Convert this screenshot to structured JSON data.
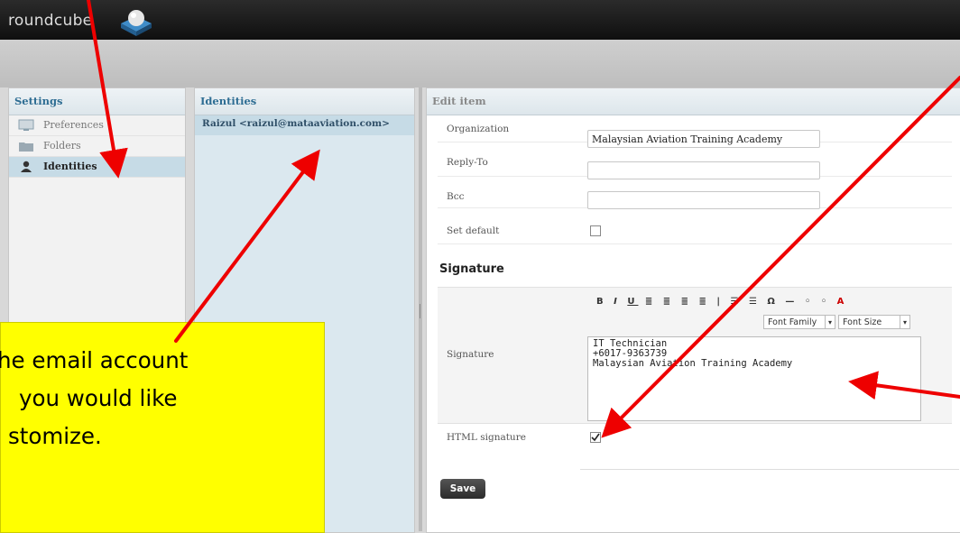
{
  "header": {
    "logo_text": "roundcube"
  },
  "settings": {
    "title": "Settings",
    "items": [
      {
        "label": "Preferences",
        "icon": "monitor-icon"
      },
      {
        "label": "Folders",
        "icon": "folder-icon"
      },
      {
        "label": "Identities",
        "icon": "user-icon",
        "selected": true
      }
    ]
  },
  "identities": {
    "title": "Identities",
    "items": [
      {
        "label": "Raizul <raizul@mataaviation.com>"
      }
    ]
  },
  "edit": {
    "title": "Edit item",
    "organization_label": "Organization",
    "organization_value": "Malaysian Aviation Training Academy",
    "replyto_label": "Reply-To",
    "replyto_value": "",
    "bcc_label": "Bcc",
    "bcc_value": "",
    "setdefault_label": "Set default",
    "section_title": "Signature",
    "signature_label": "Signature",
    "font_family": "Font Family",
    "font_size": "Font Size",
    "signature_lines": [
      "IT Technician",
      "+6017-9363739",
      "Malaysian Aviation Training Academy"
    ],
    "html_signature_label": "HTML signature",
    "html_signature_checked": true,
    "save_label": "Save"
  },
  "callout": {
    "lines": [
      "he email account",
      " you would like",
      "stomize."
    ],
    "background": "#ffff00"
  },
  "colors": {
    "arrow": "#ee0000",
    "accent": "#2e6d93"
  }
}
